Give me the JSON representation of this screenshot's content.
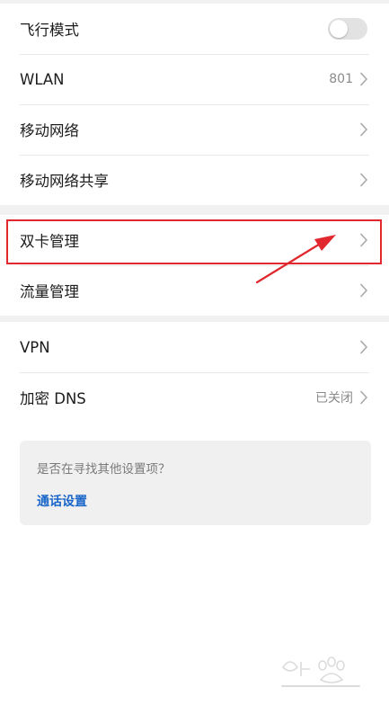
{
  "group1": {
    "airplane": {
      "label": "飞行模式",
      "enabled": false
    },
    "wlan": {
      "label": "WLAN",
      "value": "801"
    },
    "mobile_network": {
      "label": "移动网络"
    },
    "hotspot": {
      "label": "移动网络共享"
    }
  },
  "group2": {
    "dual_sim": {
      "label": "双卡管理"
    },
    "data_usage": {
      "label": "流量管理"
    }
  },
  "group3": {
    "vpn": {
      "label": "VPN"
    },
    "private_dns": {
      "label": "加密 DNS",
      "value": "已关闭"
    }
  },
  "suggestion": {
    "question": "是否在寻找其他设置项？",
    "link": "通话设置"
  },
  "colors": {
    "highlight": "#e0282e",
    "link": "#1a66c9"
  },
  "icons": {
    "chevron": "chevron-right-icon",
    "watermark": "baidu-jingyan-watermark"
  }
}
